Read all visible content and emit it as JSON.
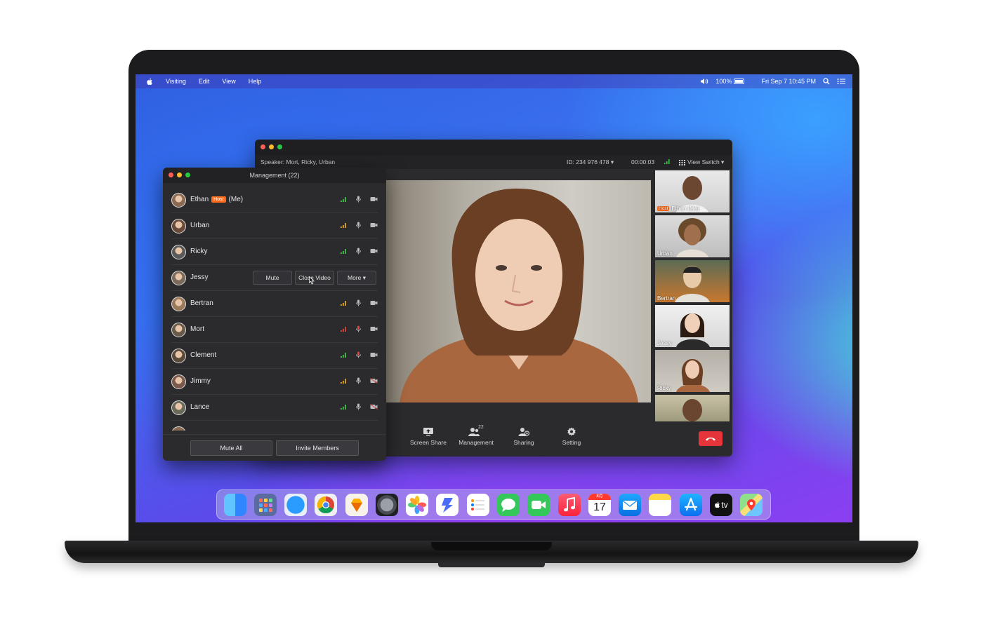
{
  "menubar": {
    "items": [
      "Visiting",
      "Edit",
      "View",
      "Help"
    ],
    "battery": "100%",
    "datetime": "Fri Sep 7  10:45 PM"
  },
  "meeting": {
    "speaker": "Speaker:  Mort, Ricky, Urban",
    "meeting_id": "ID: 234 976 478 ▾",
    "timer": "00:00:03",
    "view_switch": "View Switch ▾",
    "thumbnails": [
      {
        "name": "Ethan (Me)",
        "badge": "Host"
      },
      {
        "name": "Urban"
      },
      {
        "name": "Bertran"
      },
      {
        "name": "Jessy"
      },
      {
        "name": "Ricky"
      },
      {
        "name": ""
      }
    ],
    "controls": {
      "screen_share": "Screen Share",
      "management": "Management",
      "management_count": "22",
      "sharing": "Sharing",
      "setting": "Setting"
    }
  },
  "management": {
    "title": "Management (22)",
    "host_badge": "Host",
    "me_suffix": "(Me)",
    "participants": [
      {
        "name": "Ethan",
        "signal": "#3fc34a"
      },
      {
        "name": "Urban",
        "signal": "#e6a51e"
      },
      {
        "name": "Ricky",
        "signal": "#3fc34a"
      },
      {
        "name": "Jessy",
        "signal": "#3fc34a"
      },
      {
        "name": "Bertran",
        "signal": "#e6a51e"
      },
      {
        "name": "Mort",
        "signal": "#e2453c"
      },
      {
        "name": "Clement",
        "signal": "#3fc34a"
      },
      {
        "name": "Jimmy",
        "signal": "#e6a51e"
      },
      {
        "name": "Lance",
        "signal": "#3fc34a"
      }
    ],
    "row_actions": {
      "mute": "Mute",
      "close_video": "Close Video",
      "more": "More ▾"
    },
    "mute_all": "Mute All",
    "invite_members": "Invite Members"
  },
  "dock": {
    "calendar_month": "8月",
    "calendar_day": "17",
    "tv_label": "tv"
  },
  "colors": {
    "accent_host": "#ff6a1a",
    "end_call": "#e5353a",
    "panel_bg": "#2b2b2e"
  }
}
